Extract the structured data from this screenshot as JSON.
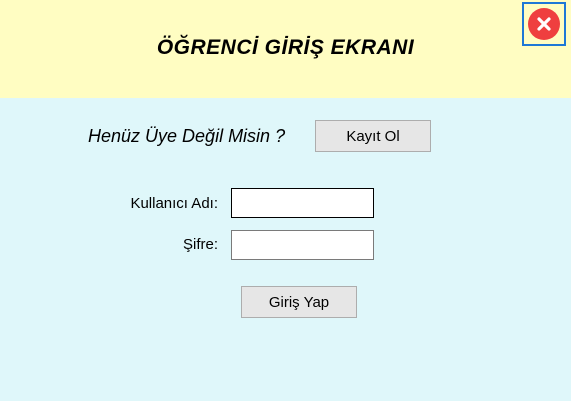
{
  "window": {
    "title": "ÖĞRENCİ GİRİŞ EKRANI",
    "close_icon": "close-icon"
  },
  "register": {
    "prompt": "Henüz Üye Değil Misin ?",
    "button_label": "Kayıt Ol"
  },
  "form": {
    "username_label": "Kullanıcı Adı:",
    "username_value": "",
    "password_label": "Şifre:",
    "password_value": "",
    "login_label": "Giriş Yap"
  },
  "colors": {
    "header_bg": "#fffdc2",
    "body_bg": "#dff7fa",
    "close_red": "#ef3f3f",
    "close_border": "#1e78d6"
  }
}
